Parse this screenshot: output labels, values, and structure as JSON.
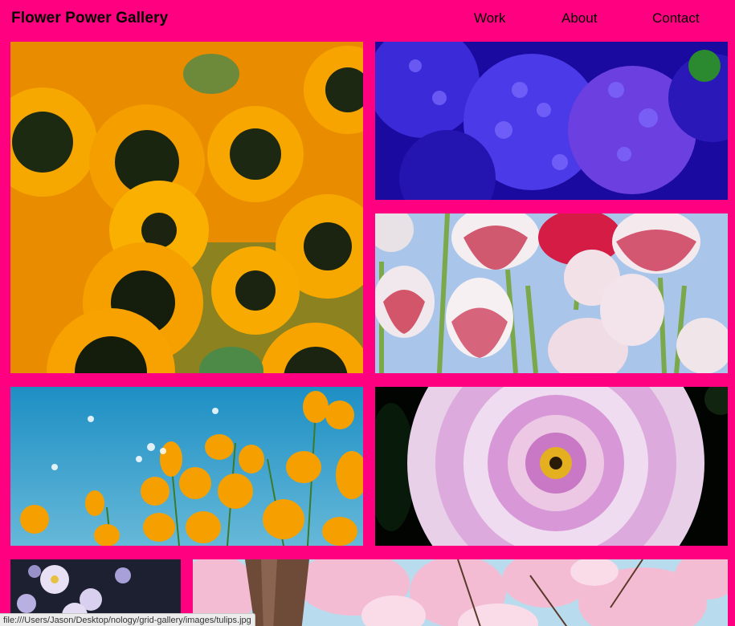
{
  "header": {
    "title": "Flower Power Gallery"
  },
  "nav": {
    "items": [
      {
        "label": "Work"
      },
      {
        "label": "About"
      },
      {
        "label": "Contact"
      }
    ]
  },
  "gallery": {
    "images": [
      {
        "name": "sunflowers"
      },
      {
        "name": "hydrangea"
      },
      {
        "name": "tulips"
      },
      {
        "name": "poppies"
      },
      {
        "name": "dahlia"
      },
      {
        "name": "asters"
      },
      {
        "name": "cherry-blossom"
      }
    ]
  },
  "status_bar": {
    "url": "file:///Users/Jason/Desktop/nology/grid-gallery/images/tulips.jpg"
  },
  "colors": {
    "background": "#ff0080",
    "text": "#000000"
  }
}
